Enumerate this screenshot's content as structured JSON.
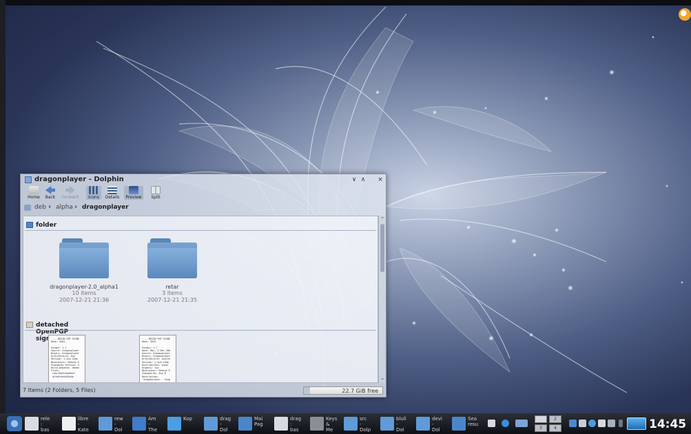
{
  "window": {
    "title": "dragonplayer - Dolphin",
    "toolbar": {
      "home": "Home",
      "back": "Back",
      "forward": "Forward",
      "icons": "Icons",
      "details": "Details",
      "preview": "Preview",
      "split": "Split"
    },
    "breadcrumb": [
      "deb",
      "alpha",
      "dragonplayer"
    ],
    "groups": {
      "folder": "folder",
      "signature": "detached OpenPGP signature"
    },
    "folders": [
      {
        "name": "dragonplayer-2.0_alpha1",
        "count": "10 items",
        "date": "2007-12-21 21:36"
      },
      {
        "name": "retar",
        "count": "3 items",
        "date": "2007-12-21 21:35"
      }
    ],
    "status": "7 Items (2 Folders, 5 Files)",
    "free_space": "22.7 GiB free",
    "free_fraction": 0.08
  },
  "taskbar": {
    "tasks": [
      {
        "label": "rele\n:\nbas"
      },
      {
        "label": "libre\n-\nKate"
      },
      {
        "label": "rew\n-\nDol"
      },
      {
        "label": "Am\n-\nThe"
      },
      {
        "label": "Kop"
      },
      {
        "label": "drag\n-\nDol"
      },
      {
        "label": "Mai\nPag"
      },
      {
        "label": "drag\n:\nbas"
      },
      {
        "label": "Keys\n&\nMe"
      },
      {
        "label": "src\n-\nDolp"
      },
      {
        "label": "bluli\n-\nDol"
      },
      {
        "label": "devi\n-\nDol"
      },
      {
        "label": "Sea\nresu"
      }
    ],
    "pager": [
      "",
      "2",
      "3",
      "4"
    ],
    "clock": "14:45"
  }
}
